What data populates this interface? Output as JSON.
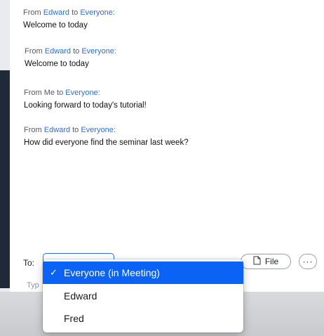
{
  "messages": [
    {
      "from_prefix": "From",
      "sender": "Edward",
      "to_word": "to",
      "recipient": "Everyone:",
      "text": "Welcome to today"
    },
    {
      "from_prefix": "From",
      "sender": "Edward",
      "to_word": "to",
      "recipient": "Everyone:",
      "text": "Welcome to today"
    },
    {
      "from_prefix": "From Me to",
      "sender": "",
      "to_word": "",
      "recipient": "Everyone:",
      "text": "Looking forward to today's tutorial!"
    },
    {
      "from_prefix": "From",
      "sender": "Edward",
      "to_word": "to",
      "recipient": "Everyone:",
      "text": "How did everyone find the seminar last week?"
    }
  ],
  "composer": {
    "to_label": "To:",
    "type_hint": "Typ",
    "file_label": "File",
    "more_label": "···"
  },
  "recipient_menu": {
    "check_glyph": "✓",
    "items": [
      {
        "label": "Everyone (in Meeting)",
        "selected": true
      },
      {
        "label": "Edward",
        "selected": false
      },
      {
        "label": "Fred",
        "selected": false
      }
    ]
  },
  "colors": {
    "link": "#2d6fd4",
    "selection": "#0b63f6"
  }
}
